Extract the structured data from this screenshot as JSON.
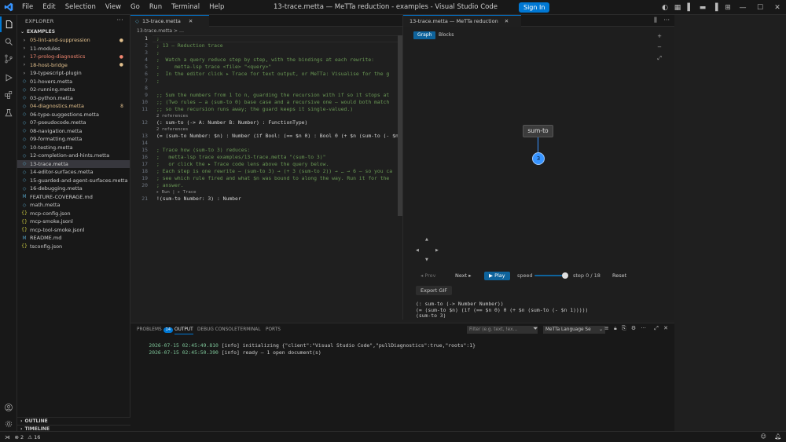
{
  "titlebar": {
    "menu": [
      "File",
      "Edit",
      "Selection",
      "View",
      "Go",
      "Run",
      "Terminal",
      "Help"
    ],
    "title": "13-trace.metta — MeTTa reduction - examples - Visual Studio Code",
    "sign_in": "Sign In"
  },
  "sidebar": {
    "header": "EXPLORER",
    "section": "EXAMPLES",
    "items": [
      {
        "label": "05-lint-and-suppression",
        "kind": "folder",
        "color": "#e2c08d",
        "badge": "●"
      },
      {
        "label": "11-modules",
        "kind": "folder",
        "color": "#cccccc",
        "badge": ""
      },
      {
        "label": "17-prolog-diagnostics",
        "kind": "folder",
        "color": "#f48771",
        "badge": "●"
      },
      {
        "label": "18-host-bridge",
        "kind": "folder",
        "color": "#e2c08d",
        "badge": "●"
      },
      {
        "label": "19-typescript-plugin",
        "kind": "folder",
        "color": "#cccccc",
        "badge": ""
      },
      {
        "label": "01-hovers.metta",
        "kind": "metta",
        "color": "#cccccc",
        "badge": ""
      },
      {
        "label": "02-running.metta",
        "kind": "metta",
        "color": "#cccccc",
        "badge": ""
      },
      {
        "label": "03-python.metta",
        "kind": "metta",
        "color": "#cccccc",
        "badge": ""
      },
      {
        "label": "04-diagnostics.metta",
        "kind": "metta",
        "color": "#e2c08d",
        "badge": "8"
      },
      {
        "label": "06-type-suggestions.metta",
        "kind": "metta",
        "color": "#cccccc",
        "badge": ""
      },
      {
        "label": "07-pseudocode.metta",
        "kind": "metta",
        "color": "#cccccc",
        "badge": ""
      },
      {
        "label": "08-navigation.metta",
        "kind": "metta",
        "color": "#cccccc",
        "badge": ""
      },
      {
        "label": "09-formatting.metta",
        "kind": "metta",
        "color": "#cccccc",
        "badge": ""
      },
      {
        "label": "10-testing.metta",
        "kind": "metta",
        "color": "#cccccc",
        "badge": ""
      },
      {
        "label": "12-completion-and-hints.metta",
        "kind": "metta",
        "color": "#cccccc",
        "badge": ""
      },
      {
        "label": "13-trace.metta",
        "kind": "metta",
        "color": "#cccccc",
        "badge": "",
        "active": true
      },
      {
        "label": "14-editor-surfaces.metta",
        "kind": "metta",
        "color": "#cccccc",
        "badge": ""
      },
      {
        "label": "15-guarded-and-agent-surfaces.metta",
        "kind": "metta",
        "color": "#cccccc",
        "badge": ""
      },
      {
        "label": "16-debugging.metta",
        "kind": "metta",
        "color": "#cccccc",
        "badge": ""
      },
      {
        "label": "FEATURE-COVERAGE.md",
        "kind": "md",
        "color": "#cccccc",
        "badge": ""
      },
      {
        "label": "math.metta",
        "kind": "metta",
        "color": "#cccccc",
        "badge": ""
      },
      {
        "label": "mcp-config.json",
        "kind": "json",
        "color": "#cccccc",
        "badge": ""
      },
      {
        "label": "mcp-smoke.jsonl",
        "kind": "json",
        "color": "#cccccc",
        "badge": ""
      },
      {
        "label": "mcp-tool-smoke.jsonl",
        "kind": "json",
        "color": "#cccccc",
        "badge": ""
      },
      {
        "label": "README.md",
        "kind": "md",
        "color": "#cccccc",
        "badge": ""
      },
      {
        "label": "tsconfig.json",
        "kind": "json",
        "color": "#cccccc",
        "badge": ""
      }
    ],
    "outline": "OUTLINE",
    "timeline": "TIMELINE"
  },
  "editor": {
    "tab": "13-trace.metta",
    "breadcrumb": "13-trace.metta > …",
    "lines": [
      {
        "n": "1",
        "t": ";",
        "c": "com"
      },
      {
        "n": "2",
        "t": "; 13 — Reduction trace",
        "c": "com"
      },
      {
        "n": "3",
        "t": ";",
        "c": "com"
      },
      {
        "n": "4",
        "t": ";  Watch a query reduce step by step, with the bindings at each rewrite:",
        "c": "com"
      },
      {
        "n": "5",
        "t": ";     metta-lsp trace <file> \"<query>\"",
        "c": "com"
      },
      {
        "n": "6",
        "t": ";  In the editor click ▸ Trace for text output, or MeTTa: Visualise for the g",
        "c": "com"
      },
      {
        "n": "7",
        "t": ";",
        "c": "com"
      },
      {
        "n": "8",
        "t": "",
        "c": "com"
      },
      {
        "n": "9",
        "t": ";; Sum the numbers from 1 to n, guarding the recursion with if so it stops at",
        "c": "com"
      },
      {
        "n": "10",
        "t": ";; (Two rules — a (sum-to 0) base case and a recursive one — would both match",
        "c": "com"
      },
      {
        "n": "11",
        "t": ";; so the recursion runs away; the guard keeps it single-valued.)",
        "c": "com"
      },
      {
        "n": "",
        "t": "2 references",
        "c": "lens"
      },
      {
        "n": "12",
        "t": "(: sum-to (-> A: Number B: Number) : FunctionType)",
        "c": "code"
      },
      {
        "n": "",
        "t": "2 references",
        "c": "lens"
      },
      {
        "n": "13",
        "t": "(= (sum-to Number: $n) : Number (if Bool: (== $n 0) : Bool 0 (+ $n (sum-to (- $n",
        "c": "code"
      },
      {
        "n": "14",
        "t": "",
        "c": "com"
      },
      {
        "n": "15",
        "t": "; Trace how (sum-to 3) reduces:",
        "c": "com"
      },
      {
        "n": "16",
        "t": ";   metta-lsp trace examples/13-trace.metta \"(sum-to 3)\"",
        "c": "com"
      },
      {
        "n": "17",
        "t": ";   or click the ▸ Trace code lens above the query below.",
        "c": "com"
      },
      {
        "n": "18",
        "t": "; Each step is one rewrite — (sum-to 3) → (+ 3 (sum-to 2)) → … → 6 — so you ca",
        "c": "com"
      },
      {
        "n": "19",
        "t": "; see which rule fired and what $n was bound to along the way. Run it for the",
        "c": "com"
      },
      {
        "n": "20",
        "t": "; answer.",
        "c": "com"
      },
      {
        "n": "",
        "t": "▸ Run | ▸ Trace",
        "c": "lens"
      },
      {
        "n": "21",
        "t": "!(sum-to Number: 3) : Number",
        "c": "code"
      }
    ]
  },
  "trace": {
    "tab": "13-trace.metta — MeTTa reduction",
    "view_graph": "Graph",
    "view_blocks": "Blocks",
    "node_label": "sum-to",
    "node_value": "3",
    "prev": "◂ Prev",
    "next": "Next ▸",
    "play": "▶ Play",
    "speed_label": "speed",
    "step_text": "step 0 / 18",
    "reset": "Reset",
    "export": "Export GIF",
    "output": [
      "(: sum-to (-> Number Number))",
      "(= (sum-to $n) (if (== $n 0) 0 (+ $n (sum-to (- $n 1)))))",
      "(sum-to 3)"
    ],
    "speed_fraction": 0.8
  },
  "panel": {
    "tabs": [
      "PROBLEMS",
      "OUTPUT",
      "DEBUG CONSOLE",
      "TERMINAL",
      "PORTS"
    ],
    "problems_count": "14",
    "filter_placeholder": "Filter (e.g. text, !ex…",
    "channel": "MeTTa Language Se",
    "log": [
      {
        "ts": "2026-07-15 02:45:49.810",
        "msg": "[info] initializing {\"client\":\"Visual Studio Code\",\"pullDiagnostics\":true,\"roots\":1}"
      },
      {
        "ts": "2026-07-15 02:45:50.390",
        "msg": "[info] ready — 1 open document(s)"
      }
    ]
  },
  "status": {
    "errors": "2",
    "warnings": "16"
  },
  "colors": {
    "accent": "#0078d4",
    "node": "#3794ff"
  }
}
